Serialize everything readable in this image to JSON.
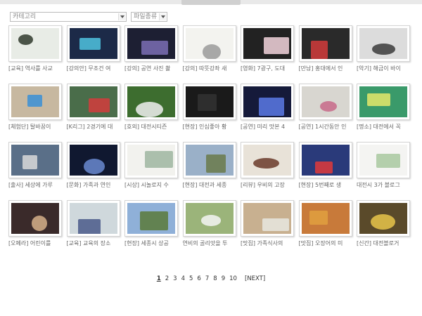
{
  "filters": {
    "category_placeholder": "카테고리",
    "filetype_placeholder": "파일종류"
  },
  "items": [
    {
      "caption": "[교육] 역사를 사교",
      "bg": "#e8ece6",
      "accent": "#2f3a2c"
    },
    {
      "caption": "[강의안] 무조건 여",
      "bg": "#1c2a48",
      "accent": "#4fc3e0"
    },
    {
      "caption": "[강의] 공연 사진 촬",
      "bg": "#1d1f33",
      "accent": "#7b6fb5"
    },
    {
      "caption": "[강의] 따뜻강좌 새",
      "bg": "#f3f3ef",
      "accent": "#9a9a9a"
    },
    {
      "caption": "[영화] 7광구, 도대",
      "bg": "#222222",
      "accent": "#f2d4dc"
    },
    {
      "caption": "[만남] 홍대에서 인",
      "bg": "#2a2a2a",
      "accent": "#d23b3b"
    },
    {
      "caption": "[악기] 해금이 바이",
      "bg": "#dcdcdc",
      "accent": "#3b3b3b"
    },
    {
      "caption": "[체험단] 탈바꿈이",
      "bg": "#c7b8a0",
      "accent": "#3a8fd6"
    },
    {
      "caption": "[K리그] 2경기에 대",
      "bg": "#4a6d4a",
      "accent": "#d43c3c"
    },
    {
      "caption": "[호외] 대전시티즌",
      "bg": "#3d6d2f",
      "accent": "#f0f0f0"
    },
    {
      "caption": "[현장] 인심좋아 황",
      "bg": "#1a1a1a",
      "accent": "#333333"
    },
    {
      "caption": "[공연] 미리 맛본 4",
      "bg": "#151a3a",
      "accent": "#5a7ae6"
    },
    {
      "caption": "[공연] 1시간동안 인",
      "bg": "#d8d6d0",
      "accent": "#c86a8a"
    },
    {
      "caption": "[명소] 대전에서 꼭",
      "bg": "#3a9a6a",
      "accent": "#e6e86a"
    },
    {
      "caption": "[출사] 세상에 가루",
      "bg": "#5a6f88",
      "accent": "#d9d9d9"
    },
    {
      "caption": "[문화] 가족과 연인",
      "bg": "#101830",
      "accent": "#6a8ad0"
    },
    {
      "caption": "[시상] 시놀로지 수",
      "bg": "#f2f2ee",
      "accent": "#9fb6a0"
    },
    {
      "caption": "[현장] 대전과 세종",
      "bg": "#9ab0c8",
      "accent": "#6a7a4a"
    },
    {
      "caption": "[리뷰] 우비의 고장",
      "bg": "#e8e2d8",
      "accent": "#6a3a2a"
    },
    {
      "caption": "[현장] 5번째로 생",
      "bg": "#2a3a7a",
      "accent": "#e03a3a"
    },
    {
      "caption": "대전시 3가 블로그",
      "bg": "#f4f4f2",
      "accent": "#a8c8a0"
    },
    {
      "caption": "[오페라] 어린이를",
      "bg": "#3a2a2a",
      "accent": "#d6b08a"
    },
    {
      "caption": "[교육] 교육의 장소",
      "bg": "#cfd8dc",
      "accent": "#4a5a8a"
    },
    {
      "caption": "[현장] 세종시 상공",
      "bg": "#8fb0d8",
      "accent": "#5a7a3a"
    },
    {
      "caption": "연비의 골리앗을 투",
      "bg": "#9bb47a",
      "accent": "#f4f4f4"
    },
    {
      "caption": "[맛집] 가족식사의",
      "bg": "#c8b090",
      "accent": "#e8e8e0"
    },
    {
      "caption": "[맛집] 오장어의 미",
      "bg": "#c87a3a",
      "accent": "#e0a040"
    },
    {
      "caption": "[신간] 대전블로거",
      "bg": "#5a4a2a",
      "accent": "#e8c44a"
    }
  ],
  "pagination": {
    "pages": [
      "1",
      "2",
      "3",
      "4",
      "5",
      "6",
      "7",
      "8",
      "9",
      "10"
    ],
    "current": "1",
    "next_label": "[NEXT]"
  }
}
